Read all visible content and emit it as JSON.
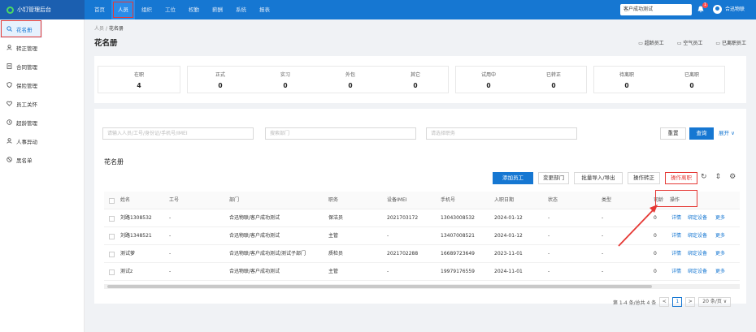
{
  "topbar": {
    "brand": "小钉管理后台",
    "nav": [
      "首页",
      "人员",
      "组织",
      "工位",
      "权勤",
      "薪酬",
      "系统",
      "报表"
    ],
    "active_index": 1,
    "search_value": "客户成功测试",
    "bell_count": "1",
    "company": "合迅物联"
  },
  "sidebar": {
    "items": [
      {
        "label": "花名册",
        "icon": "search-icon",
        "active": true
      },
      {
        "label": "转正管理",
        "icon": "person-icon"
      },
      {
        "label": "合同管理",
        "icon": "document-icon"
      },
      {
        "label": "保险管理",
        "icon": "shield-icon"
      },
      {
        "label": "员工关怀",
        "icon": "heart-icon"
      },
      {
        "label": "超龄管理",
        "icon": "clock-icon"
      },
      {
        "label": "人事异动",
        "icon": "person-icon"
      },
      {
        "label": "黑名单",
        "icon": "ban-icon"
      }
    ]
  },
  "breadcrumb": {
    "parent": "人员",
    "separator": "/",
    "current": "花名册"
  },
  "page_title": "花名册",
  "header_actions": [
    "超龄员工",
    "空气员工",
    "已离职员工"
  ],
  "stats": {
    "group1": [
      {
        "label": "在职",
        "value": "4"
      }
    ],
    "group2": [
      {
        "label": "正式",
        "value": "0"
      },
      {
        "label": "实习",
        "value": "0"
      },
      {
        "label": "外包",
        "value": "0"
      },
      {
        "label": "其它",
        "value": "0"
      }
    ],
    "group3": [
      {
        "label": "试用中",
        "value": "0"
      },
      {
        "label": "已转正",
        "value": "0"
      }
    ],
    "group4": [
      {
        "label": "待离职",
        "value": "0"
      },
      {
        "label": "已离职",
        "value": "0"
      }
    ]
  },
  "filter": {
    "search_placeholder": "请输入人员/工号/身份证/手机号/IMEI",
    "dept_placeholder": "搜索部门",
    "position_placeholder": "请选择职务",
    "reset": "重置",
    "query": "查询",
    "expand": "展开 ∨"
  },
  "table": {
    "title": "花名册",
    "actions": [
      "添加员工",
      "变更部门",
      "批量导入/导出",
      "操作转正",
      "操作离职"
    ],
    "columns": [
      "姓名",
      "工号",
      "部门",
      "职务",
      "设备IMEI",
      "手机号",
      "入职日期",
      "状态",
      "类型",
      "司龄",
      "操作"
    ],
    "rows": [
      {
        "name": "刘路1308532",
        "no": "-",
        "dept": "合迅物联/客户成功测试",
        "pos": "保洁员",
        "imei": "2021703172",
        "phone": "13043008532",
        "date": "2024-01-12",
        "status": "-",
        "type": "-",
        "age": "0"
      },
      {
        "name": "刘路1348521",
        "no": "-",
        "dept": "合迅物联/客户成功测试",
        "pos": "主管",
        "imei": "-",
        "phone": "13407008521",
        "date": "2024-01-12",
        "status": "-",
        "type": "-",
        "age": "0"
      },
      {
        "name": "测试萝",
        "no": "-",
        "dept": "合迅物联/客户成功测试/测试子部门",
        "pos": "质检员",
        "imei": "2021702288",
        "phone": "16689723649",
        "date": "2023-11-01",
        "status": "-",
        "type": "-",
        "age": "0"
      },
      {
        "name": "测试z",
        "no": "-",
        "dept": "合迅物联/客户成功测试",
        "pos": "主管",
        "imei": "-",
        "phone": "19979176559",
        "date": "2024-11-01",
        "status": "-",
        "type": "-",
        "age": "0"
      }
    ],
    "op_links": [
      "详情",
      "绑定设备",
      "更多"
    ]
  },
  "pagination": {
    "summary": "第 1-4 条/总共 4 条",
    "prev": "<",
    "page": "1",
    "next": ">",
    "size": "20 条/页 ∨"
  }
}
